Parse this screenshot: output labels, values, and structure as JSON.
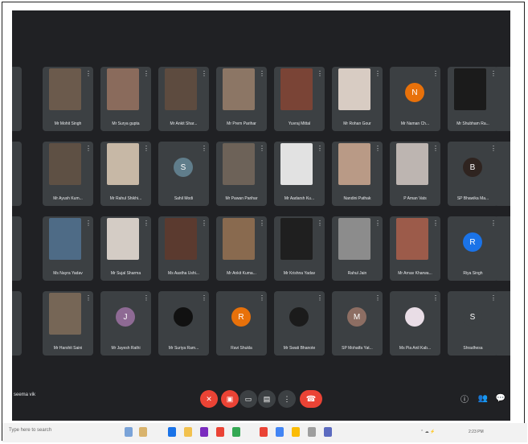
{
  "meeting": {
    "self_label": "seema vik",
    "participants": [
      {
        "name": "Mr Mohit Singh",
        "kind": "video",
        "color": "#6b5a4c"
      },
      {
        "name": "Mr Surya gupta",
        "kind": "video",
        "color": "#8a6b5c"
      },
      {
        "name": "Mr Ankit Shar...",
        "kind": "video",
        "color": "#5d4b3f"
      },
      {
        "name": "Mr Prem Parihar",
        "kind": "video",
        "color": "#8c7665"
      },
      {
        "name": "Yuvraj Mittal",
        "kind": "video",
        "color": "#7a4436"
      },
      {
        "name": "Mr Rohan Gour",
        "kind": "video",
        "color": "#d8ccc3"
      },
      {
        "name": "Mr Naman Ch...",
        "kind": "avatar",
        "color": "#e8710a",
        "initial": "N"
      },
      {
        "name": "Mr Shubham Ra...",
        "kind": "video",
        "color": "#1b1b1b"
      },
      {
        "name": "Mr Ayush Kum...",
        "kind": "video",
        "color": "#5e5044"
      },
      {
        "name": "Mr Rahul Shikhi...",
        "kind": "video",
        "color": "#c7b8a6"
      },
      {
        "name": "Sahil Modi",
        "kind": "avatar",
        "color": "#607d8b",
        "initial": "S"
      },
      {
        "name": "Mr Pawan Parihar",
        "kind": "video",
        "color": "#6d6258"
      },
      {
        "name": "Mr Aadarsh Ku...",
        "kind": "video",
        "color": "#e2e2e2"
      },
      {
        "name": "Nandini Pathak",
        "kind": "video",
        "color": "#b99a86"
      },
      {
        "name": "P Aman Vats",
        "kind": "video",
        "color": "#bdb5b1"
      },
      {
        "name": "SP Bhawika Ma...",
        "kind": "avatar",
        "color": "#2f2420",
        "initial": "B"
      },
      {
        "name": "Ms Nayra Yadav",
        "kind": "video",
        "color": "#4e6b86"
      },
      {
        "name": "Mr Sujal Sharma",
        "kind": "video",
        "color": "#d4ccc5"
      },
      {
        "name": "Ms Aastha Ushi...",
        "kind": "video",
        "color": "#5b3a2f"
      },
      {
        "name": "Mr Ankit Kuma...",
        "kind": "video",
        "color": "#896a4f"
      },
      {
        "name": "Mr Krishna Yadav",
        "kind": "video",
        "color": "#1f1f1f"
      },
      {
        "name": "Rahul Jain",
        "kind": "video",
        "color": "#8c8c8c"
      },
      {
        "name": "Mr Arnav Kharwa...",
        "kind": "video",
        "color": "#9c5b4a"
      },
      {
        "name": "Riya Singh",
        "kind": "avatar",
        "color": "#1a73e8",
        "initial": "R"
      },
      {
        "name": "Mr Harshit Saini",
        "kind": "video",
        "color": "#766656"
      },
      {
        "name": "Mr Jayesh Rathi",
        "kind": "avatar",
        "color": "#8e6a94",
        "initial": "J"
      },
      {
        "name": "Mr Suriya Ram...",
        "kind": "avatar",
        "color": "#111111",
        "initial": ""
      },
      {
        "name": "Ravi Shukla",
        "kind": "avatar",
        "color": "#e8710a",
        "initial": "R"
      },
      {
        "name": "Mr Swati Bhanote",
        "kind": "avatar",
        "color": "#1b1b1b",
        "initial": ""
      },
      {
        "name": "SP Mohatfa Yat...",
        "kind": "avatar",
        "color": "#8d6e63",
        "initial": "M"
      },
      {
        "name": "Ms Pia Anil Kab...",
        "kind": "avatar",
        "color": "#e9dde6",
        "initial": ""
      },
      {
        "name": "Shradhesa",
        "kind": "avatar",
        "color": "#3c4043",
        "initial": "S"
      }
    ]
  },
  "controls": {
    "mic_label": "mic",
    "cam_label": "camera",
    "present_label": "present",
    "captions_label": "cc",
    "more_label": "more",
    "hangup_label": "leave"
  },
  "taskbar": {
    "search_text": "Type here to search",
    "time_text": "2:23 PM"
  },
  "colors": {
    "meet_bg": "#202124",
    "tile_bg": "#3c4043",
    "danger": "#ea4335"
  }
}
